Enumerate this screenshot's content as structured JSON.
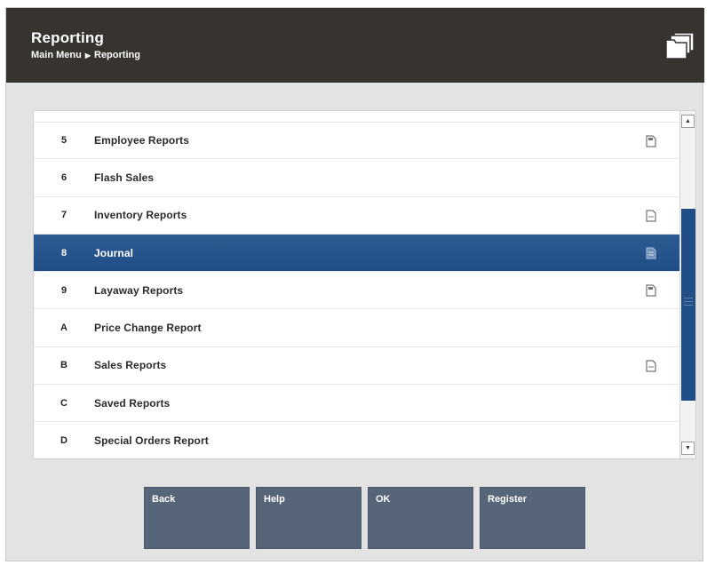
{
  "header": {
    "title": "Reporting",
    "breadcrumb": [
      "Main Menu",
      "Reporting"
    ],
    "icon": "folder-icon"
  },
  "menu": {
    "items": [
      {
        "key": "5",
        "label": "Employee Reports",
        "icon": "document-icon"
      },
      {
        "key": "6",
        "label": "Flash Sales",
        "icon": ""
      },
      {
        "key": "7",
        "label": "Inventory Reports",
        "icon": "document-icon"
      },
      {
        "key": "8",
        "label": "Journal",
        "icon": "document-icon",
        "selected": true
      },
      {
        "key": "9",
        "label": "Layaway Reports",
        "icon": "document-icon"
      },
      {
        "key": "A",
        "label": "Price Change Report",
        "icon": ""
      },
      {
        "key": "B",
        "label": "Sales Reports",
        "icon": "document-icon"
      },
      {
        "key": "C",
        "label": "Saved Reports",
        "icon": ""
      },
      {
        "key": "D",
        "label": "Special Orders Report",
        "icon": ""
      }
    ]
  },
  "buttons": {
    "back": "Back",
    "help": "Help",
    "ok": "OK",
    "register": "Register"
  },
  "colors": {
    "header_bg": "#37332f",
    "selected_row": "#1f4d86",
    "button_bg": "#566578"
  }
}
